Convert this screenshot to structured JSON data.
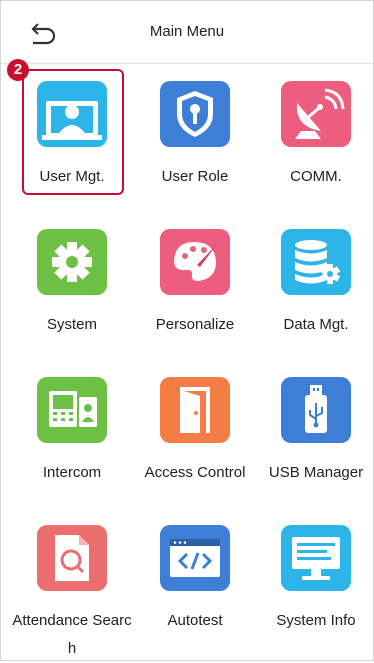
{
  "header": {
    "title": "Main Menu",
    "back_icon": "back-arrow-icon"
  },
  "step_badge": "2",
  "menu": {
    "user_mgt": "User Mgt.",
    "user_role": "User Role",
    "comm": "COMM.",
    "system": "System",
    "personalize": "Personalize",
    "data_mgt": "Data Mgt.",
    "intercom": "Intercom",
    "access_control": "Access Control",
    "usb_manager": "USB Manager",
    "attendance_search": "Attendance Search",
    "autotest": "Autotest",
    "system_info": "System Info"
  },
  "colors": {
    "highlight": "#c8102e",
    "badge": "#c8102e"
  }
}
